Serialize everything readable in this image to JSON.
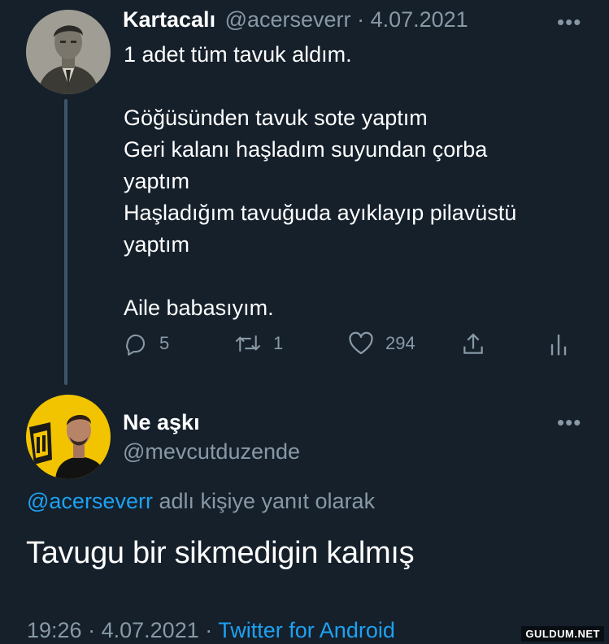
{
  "tweet1": {
    "display_name": "Kartacalı",
    "handle": "@acerseverr",
    "separator": "·",
    "date": "4.07.2021",
    "more": "•••",
    "text": "1 adet tüm tavuk aldım.\n\nGöğüsünden tavuk sote yaptım\nGeri kalanı haşladım suyundan çorba\nyaptım\nHaşladığım tavuğuda ayıklayıp pilavüstü\nyaptım\n\nAile babasıyım.",
    "replies": "5",
    "retweets": "1",
    "likes": "294",
    "avatar_icon": "vintage-portrait-avatar"
  },
  "tweet2": {
    "display_name": "Ne aşkı",
    "handle": "@mevcutduzende",
    "more": "•••",
    "reply_to_mention": "@acerseverr",
    "reply_to_suffix": " adlı kişiye yanıt olarak",
    "text": "Tavugu bir sikmedigin kalmış",
    "time": "19:26",
    "separator": "·",
    "date": "4.07.2021",
    "separator2": "·",
    "source": "Twitter for Android",
    "avatar_icon": "man-with-yellow-badge-avatar"
  },
  "icons": {
    "reply": "reply-icon",
    "retweet": "retweet-icon",
    "like": "heart-icon",
    "share": "share-icon",
    "analytics": "analytics-icon"
  },
  "colors": {
    "background": "#15202b",
    "muted": "#8899a6",
    "link": "#1da1f2",
    "avatar2_yellow": "#f2c400"
  },
  "watermark": "GULDUM.NET"
}
